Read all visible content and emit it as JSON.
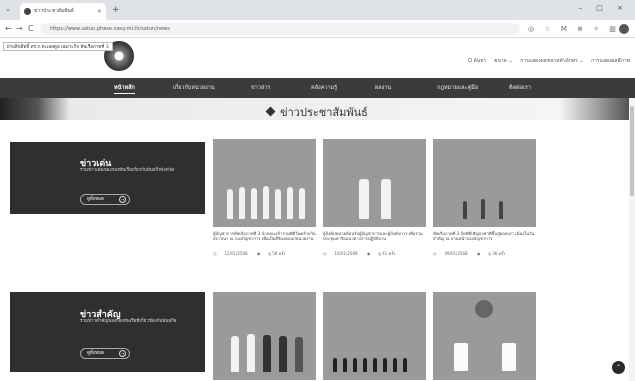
{
  "browser": {
    "tab_title": "ข่าวประชาสัมพันธ์",
    "tab_close": "×",
    "new_tab": "+",
    "tab_menu": "⌄",
    "window_controls": "–  □  ×",
    "back": "←",
    "forward": "→",
    "reload": "C",
    "url": "https://www.satun.phase.navy.mi.th/satun/news",
    "toolbar_icons": "◎ ☆ M ⊕ ✧ ▥ ≡"
  },
  "status_tooltip": "ฝ่ายลิขสิทธิ์ ทร.ก.ทะเลสตูล เฉพาะกิจ ทัพเรือภาคที่ 3",
  "header": {
    "search_label": "Q ค้นหา",
    "font_size": "ขนาด ⌄",
    "font_size_a": "ก",
    "lang_label": "การแสดงผลขนาดตัวอักษร ⌄",
    "contrast_label": "การแสดงผลสีภาพ"
  },
  "nav": {
    "items": [
      {
        "label": "หน้าหลัก"
      },
      {
        "label": "เกี่ยวกับหน่วยงาน"
      },
      {
        "label": "ข่าวสาร"
      },
      {
        "label": "คลังความรู้"
      },
      {
        "label": "ผลงาน"
      },
      {
        "label": "กฎหมายและคู่มือ"
      },
      {
        "label": "ติดต่อเรา"
      }
    ]
  },
  "page_title": "ข่าวประชาสัมพันธ์",
  "sections": [
    {
      "title": "ข่าวเด่น",
      "desc": "รวมข่าวเด่นของกองทัพเรือเกี่ยวกับพันธกิจจังหวัด",
      "button": "ดูทั้งหมด",
      "cards": [
        {
          "caption": "ผู้บัญชาการทัพเรือภาคที่ 3 นำคณะเข้าร่วมพิธีวันคล้ายวันสถาปนา ณ กองบัญชาการ เพื่อเป็นสิริมงคลแก่หน่วยงาน",
          "date": "12/01/2568",
          "views": "ดู 58 ครั้ง"
        },
        {
          "caption": "ผู้บังคับหน่วยต้อนรับผู้บัญชาการและผู้บังคับการ เพื่อร่วมประชุมหารือแนวทางการปฏิบัติงาน",
          "date": "10/01/2568",
          "views": "ดู 41 ครั้ง"
        },
        {
          "caption": "ทัพเรือภาคที่ 3 จัดพิธีเชิญธงชาติขึ้นสู่ยอดเสา เนื่องในวันสำคัญ ณ ลานหน้ากองบัญชาการ",
          "date": "09/01/2568",
          "views": "ดู 36 ครั้ง"
        }
      ]
    },
    {
      "title": "ข่าวสำคัญ",
      "desc": "รวมข่าวสำคัญของกองทัพเรือที่เกี่ยวข้องกับพันธกิจ",
      "button": "ดูทั้งหมด",
      "cards": [
        {
          "caption": "",
          "date": "",
          "views": ""
        },
        {
          "caption": "",
          "date": "",
          "views": ""
        },
        {
          "caption": "",
          "date": "",
          "views": ""
        }
      ]
    }
  ],
  "icons": {
    "calendar": "◷",
    "eye": "◉",
    "arrow": "→",
    "back_to_top": "⌃"
  }
}
